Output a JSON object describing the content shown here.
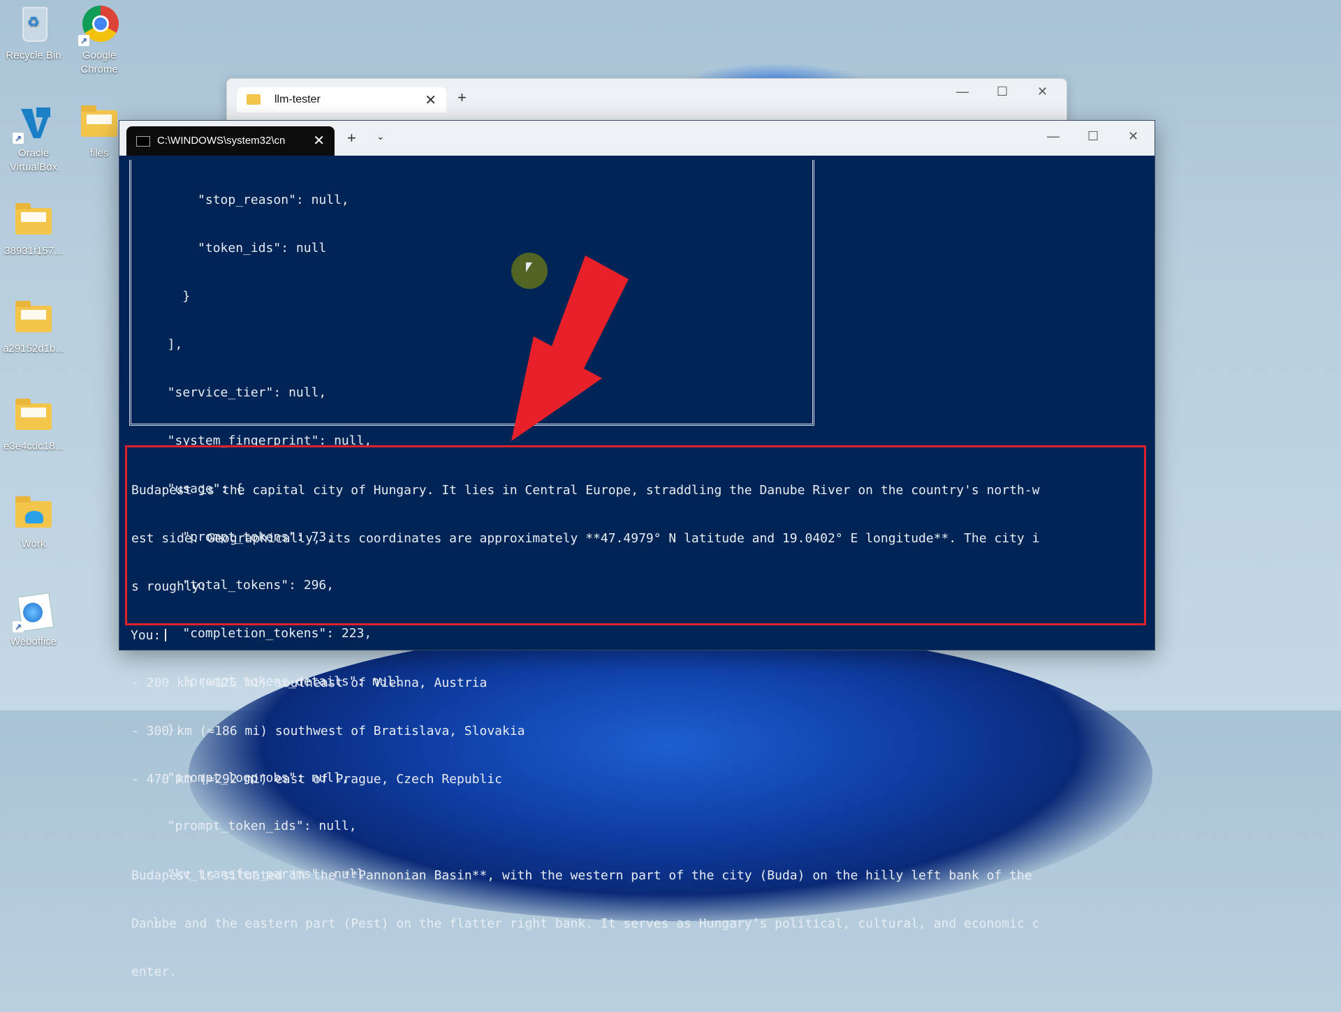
{
  "desktop": {
    "icons": [
      {
        "label": "Recycle Bin"
      },
      {
        "label": "Google Chrome"
      },
      {
        "label": "Oracle VirtualBox"
      },
      {
        "label": "files"
      },
      {
        "label": "38931f157..."
      },
      {
        "label": "a29152d1b..."
      },
      {
        "label": "e3e4cdc18..."
      },
      {
        "label": "Work"
      },
      {
        "label": "Weboffice"
      }
    ]
  },
  "explorer": {
    "tab_title": "llm-tester",
    "close": "✕",
    "new_tab": "+",
    "min": "—",
    "max": "☐",
    "close_win": "✕"
  },
  "terminal": {
    "tab_title": "C:\\WINDOWS\\system32\\cn",
    "close": "✕",
    "new_tab": "+",
    "dropdown": "⌄",
    "min": "—",
    "max": "☐",
    "close_win": "✕",
    "json_lines": [
      "      \"stop_reason\": null,",
      "      \"token_ids\": null",
      "    }",
      "  ],",
      "  \"service_tier\": null,",
      "  \"system_fingerprint\": null,",
      "  \"usage\": {",
      "    \"prompt_tokens\": 73,",
      "    \"total_tokens\": 296,",
      "    \"completion_tokens\": 223,",
      "    \"prompt_tokens_details\": null",
      "  },",
      "  \"prompt_logprobs\": null,",
      "  \"prompt_token_ids\": null,",
      "  \"kv_transfer_params\": null",
      "}"
    ],
    "response_lines": [
      "Budapest is the capital city of Hungary. It lies in Central Europe, straddling the Danube River on the country's north-w",
      "est side. Geographically, its coordinates are approximately **47.4979° N latitude and 19.0402° E longitude**. The city i",
      "s roughly:",
      "",
      "- 200 km (≈125 mi) southeast of Vienna, Austria",
      "- 300 km (≈186 mi) southwest of Bratislava, Slovakia",
      "- 470 km (≈292 mi) east of Prague, Czech Republic",
      "",
      "Budapest is situated in the **Pannonian Basin**, with the western part of the city (Buda) on the hilly left bank of the",
      "Danube and the eastern part (Pest) on the flatter right bank. It serves as Hungary’s political, cultural, and economic c",
      "enter."
    ],
    "prompt": "You:"
  },
  "colors": {
    "console_bg": "#012456",
    "highlight": "#e0202a",
    "arrow": "#e8202a"
  }
}
